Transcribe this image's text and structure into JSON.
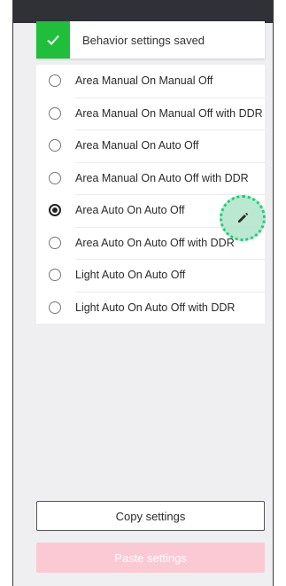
{
  "toast": {
    "message": "Behavior settings saved",
    "icon": "check-icon",
    "accent_color": "#1fbf3c"
  },
  "behavior_options": {
    "selected_index": 4,
    "items": [
      {
        "label": "Area Manual On Manual Off",
        "selected": false
      },
      {
        "label": "Area Manual On Manual Off with DDR",
        "selected": false
      },
      {
        "label": "Area Manual On Auto Off",
        "selected": false
      },
      {
        "label": "Area Manual On Auto Off with DDR",
        "selected": false
      },
      {
        "label": "Area Auto On Auto Off",
        "selected": true
      },
      {
        "label": "Area Auto On Auto Off with DDR",
        "selected": false
      },
      {
        "label": "Light Auto On Auto Off",
        "selected": false
      },
      {
        "label": "Light Auto On Auto Off with DDR",
        "selected": false
      }
    ]
  },
  "edit_button": {
    "icon": "pencil-icon"
  },
  "actions": {
    "copy_label": "Copy settings",
    "paste_label": "Paste settings",
    "paste_color": "#fbc9d4"
  }
}
